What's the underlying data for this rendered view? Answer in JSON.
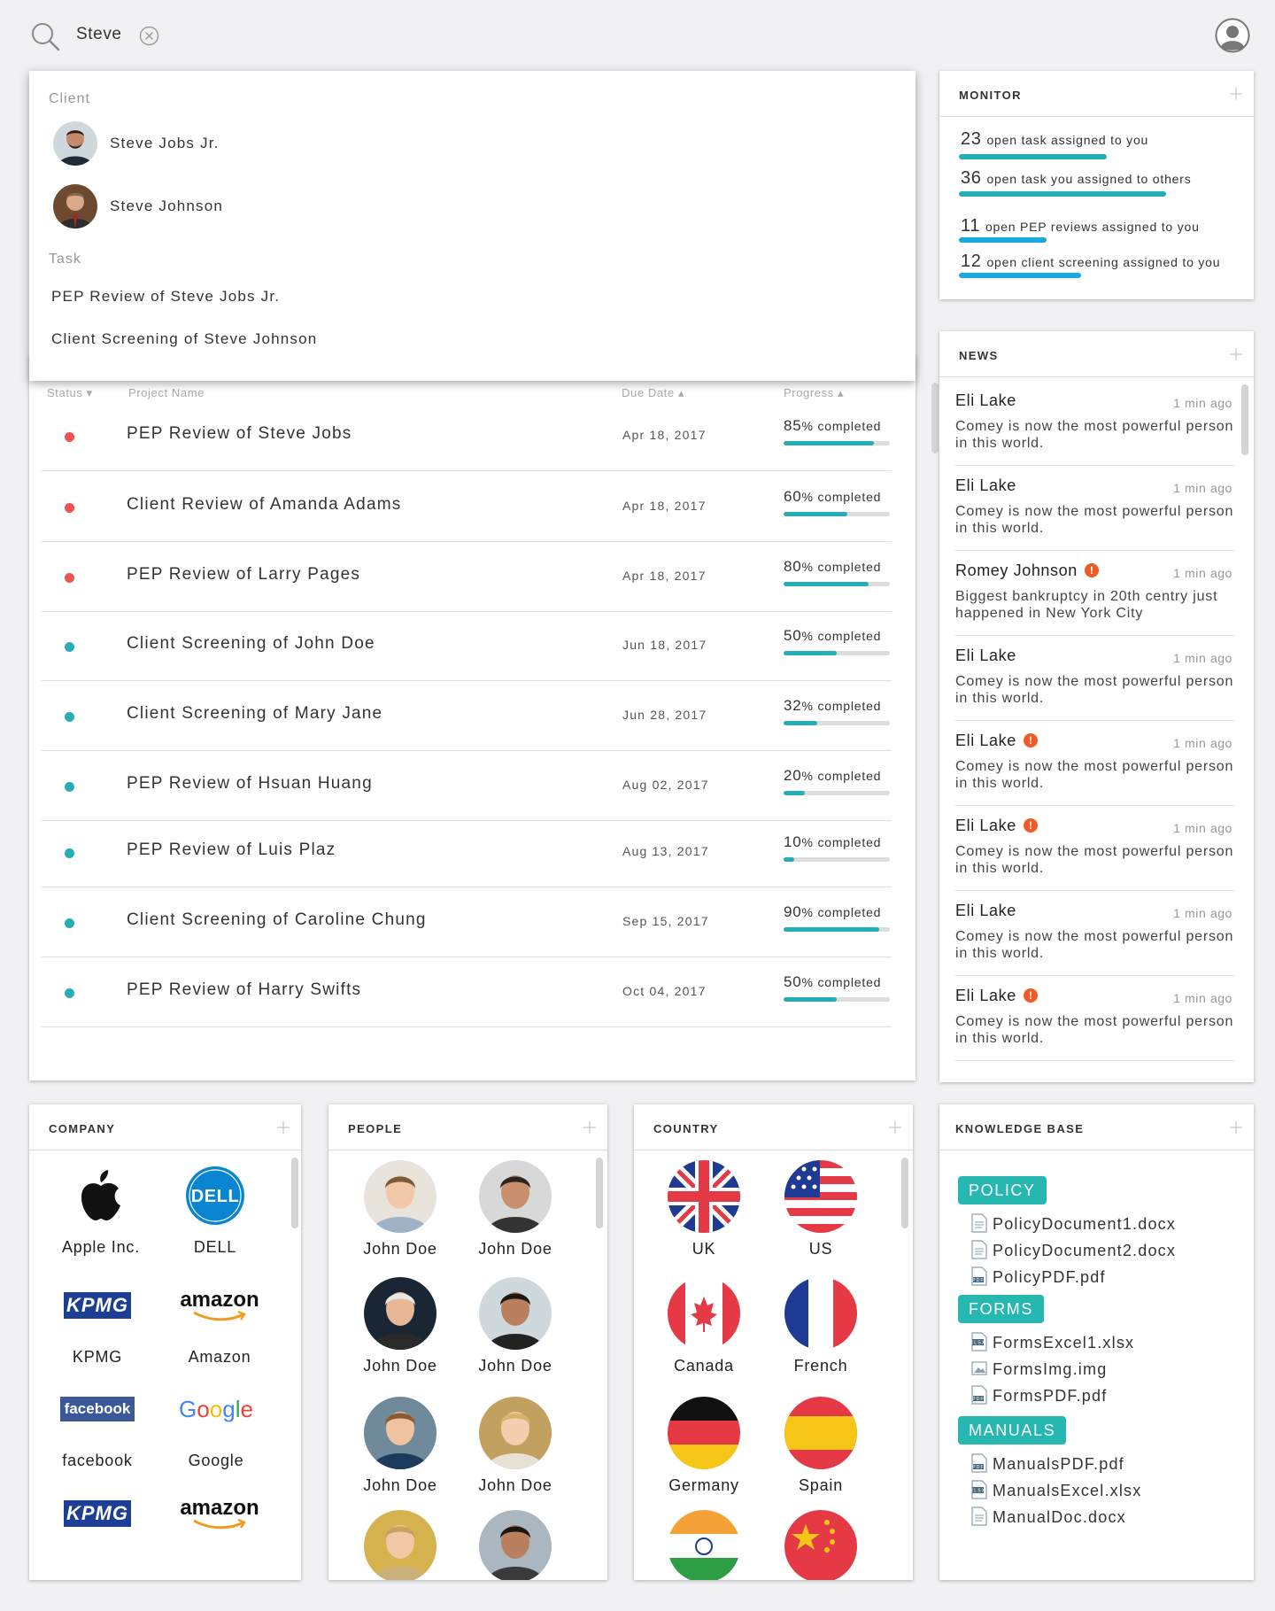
{
  "search": {
    "query": "Steve",
    "icon": "search-icon"
  },
  "dropdown": {
    "client_heading": "Client",
    "clients": [
      {
        "name": "Steve Jobs Jr."
      },
      {
        "name": "Steve Johnson"
      }
    ],
    "task_heading": "Task",
    "tasks": [
      "PEP Review of Steve Jobs Jr.",
      "Client Screening of Steve Johnson"
    ]
  },
  "table": {
    "headers": {
      "status": "Status",
      "project": "Project Name",
      "due": "Due Date",
      "progress": "Progress"
    },
    "completed_label": "% completed",
    "rows": [
      {
        "status": "red",
        "name": "PEP Review of Steve Jobs",
        "due": "Apr 18, 2017",
        "progress": 85
      },
      {
        "status": "red",
        "name": "Client Review of Amanda Adams",
        "due": "Apr 18, 2017",
        "progress": 60
      },
      {
        "status": "red",
        "name": "PEP Review of Larry Pages",
        "due": "Apr 18, 2017",
        "progress": 80
      },
      {
        "status": "teal",
        "name": "Client Screening of John Doe",
        "due": "Jun 18, 2017",
        "progress": 50
      },
      {
        "status": "teal",
        "name": "Client Screening of Mary Jane",
        "due": "Jun 28, 2017",
        "progress": 32
      },
      {
        "status": "teal",
        "name": "PEP Review of Hsuan Huang",
        "due": "Aug 02, 2017",
        "progress": 20
      },
      {
        "status": "teal",
        "name": "PEP Review of Luis Plaz",
        "due": "Aug 13, 2017",
        "progress": 10
      },
      {
        "status": "teal",
        "name": "Client Screening of Caroline Chung",
        "due": "Sep 15, 2017",
        "progress": 90
      },
      {
        "status": "teal",
        "name": "PEP Review of Harry Swifts",
        "due": "Oct 04, 2017",
        "progress": 50
      }
    ]
  },
  "monitor": {
    "title": "MONITOR",
    "items": [
      {
        "count": "23",
        "text": "open task assigned to you",
        "color": "#26aeb8",
        "level": 0.47
      },
      {
        "count": "36",
        "text": "open task you assigned to others",
        "color": "#26aeb8",
        "level": 0.66
      },
      {
        "count": "11",
        "text": "open PEP reviews assigned to you",
        "color": "#1aa8e0",
        "level": 0.28
      },
      {
        "count": "12",
        "text": "open client screening assigned to you",
        "color": "#1aa8e0",
        "level": 0.39
      }
    ]
  },
  "news": {
    "title": "NEWS",
    "items": [
      {
        "who": "Eli Lake",
        "alert": false,
        "time": "1 min ago",
        "body": "Comey is now the most powerful person in this world."
      },
      {
        "who": "Eli Lake",
        "alert": false,
        "time": "1 min ago",
        "body": "Comey is now the most powerful person in this world."
      },
      {
        "who": "Romey Johnson",
        "alert": true,
        "time": "1 min ago",
        "body": "Biggest bankruptcy in 20th centry just happened in New York City"
      },
      {
        "who": "Eli Lake",
        "alert": false,
        "time": "1 min ago",
        "body": "Comey is now the most powerful person in this world."
      },
      {
        "who": "Eli Lake",
        "alert": true,
        "time": "1 min ago",
        "body": "Comey is now the most powerful person in this world."
      },
      {
        "who": "Eli Lake",
        "alert": true,
        "time": "1 min ago",
        "body": "Comey is now the most powerful person in this world."
      },
      {
        "who": "Eli Lake",
        "alert": false,
        "time": "1 min ago",
        "body": "Comey is now the most powerful person in this world."
      },
      {
        "who": "Eli Lake",
        "alert": true,
        "time": "1 min ago",
        "body": "Comey is now the most powerful person in this world."
      }
    ]
  },
  "company": {
    "title": "COMPANY",
    "items": [
      {
        "label": "Apple Inc.",
        "logo": "apple-logo"
      },
      {
        "label": "DELL",
        "logo": "dell-logo",
        "logo_text": "DELL"
      },
      {
        "label": "KPMG",
        "logo": "kpmg-logo",
        "logo_text": "KPMG"
      },
      {
        "label": "Amazon",
        "logo": "amazon-logo",
        "logo_text": "amazon"
      },
      {
        "label": "facebook",
        "logo": "facebook-logo",
        "logo_text": "facebook"
      },
      {
        "label": "Google",
        "logo": "google-logo",
        "logo_text": "Google"
      },
      {
        "label": "",
        "logo": "kpmg-logo",
        "logo_text": "KPMG"
      },
      {
        "label": "",
        "logo": "amazon-logo",
        "logo_text": "amazon"
      }
    ]
  },
  "people": {
    "title": "PEOPLE",
    "items": [
      {
        "label": "John Doe"
      },
      {
        "label": "John Doe"
      },
      {
        "label": "John Doe"
      },
      {
        "label": "John Doe"
      },
      {
        "label": "John Doe"
      },
      {
        "label": "John Doe"
      },
      {
        "label": ""
      },
      {
        "label": ""
      }
    ]
  },
  "country": {
    "title": "COUNTRY",
    "items": [
      {
        "label": "UK",
        "flag": "uk-flag"
      },
      {
        "label": "US",
        "flag": "us-flag"
      },
      {
        "label": "Canada",
        "flag": "canada-flag"
      },
      {
        "label": "French",
        "flag": "france-flag"
      },
      {
        "label": "Germany",
        "flag": "germany-flag"
      },
      {
        "label": "Spain",
        "flag": "spain-flag"
      },
      {
        "label": "",
        "flag": "india-flag"
      },
      {
        "label": "",
        "flag": "china-flag"
      }
    ]
  },
  "knowledge_base": {
    "title": "KNOWLEDGE BASE",
    "groups": [
      {
        "tag": "POLICY",
        "files": [
          {
            "name": "PolicyDocument1.docx",
            "icon": "doc-icon"
          },
          {
            "name": "PolicyDocument2.docx",
            "icon": "doc-icon"
          },
          {
            "name": "PolicyPDF.pdf",
            "icon": "pdf-icon"
          }
        ]
      },
      {
        "tag": "FORMS",
        "files": [
          {
            "name": "FormsExcel1.xlsx",
            "icon": "xlsx-icon"
          },
          {
            "name": "FormsImg.img",
            "icon": "image-icon"
          },
          {
            "name": "FormsPDF.pdf",
            "icon": "pdf-icon"
          }
        ]
      },
      {
        "tag": "MANUALS",
        "files": [
          {
            "name": "ManualsPDF.pdf",
            "icon": "pdf-icon"
          },
          {
            "name": "ManualsExcel.xlsx",
            "icon": "xlsx-icon"
          },
          {
            "name": "ManualDoc.docx",
            "icon": "doc-icon"
          }
        ]
      }
    ]
  },
  "colors": {
    "accent": "#26aeb8",
    "red_status": "#ef5350",
    "alert": "#f05a28"
  }
}
